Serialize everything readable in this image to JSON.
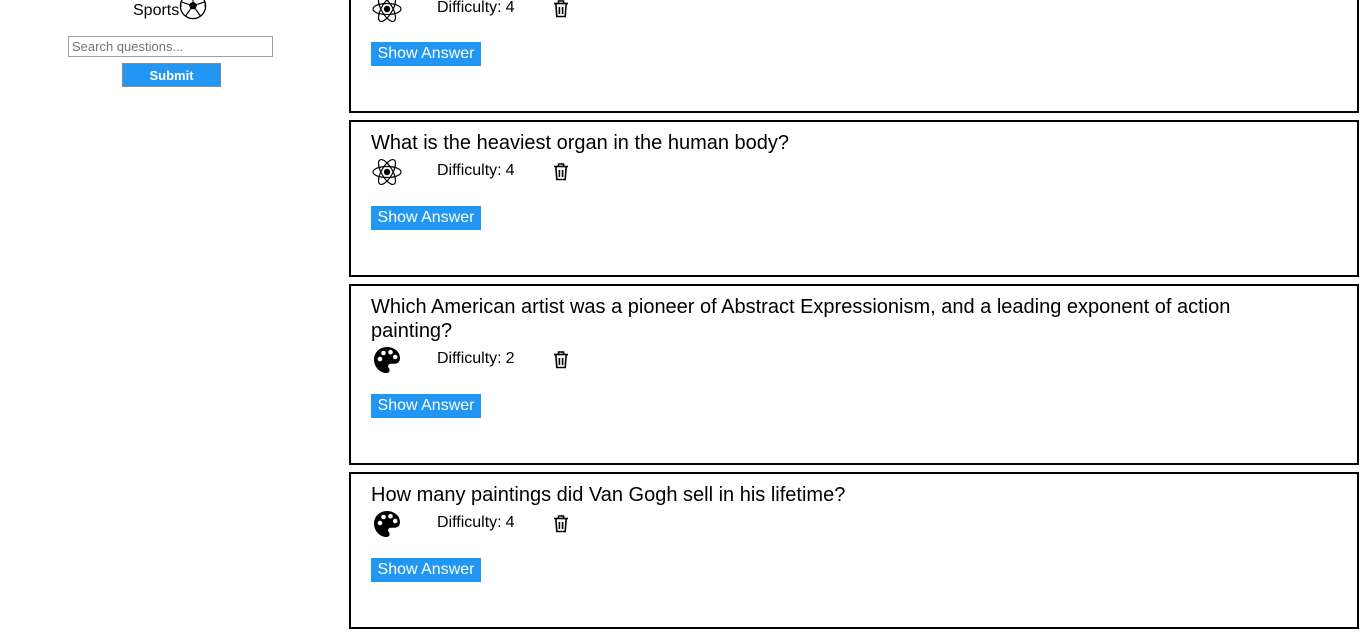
{
  "sidebar": {
    "category_label": "Sports",
    "category_icon": "soccer-ball-icon",
    "search_placeholder": "Search questions...",
    "search_value": "",
    "submit_label": "Submit"
  },
  "questions": [
    {
      "text": "",
      "category_icon": "atom-icon",
      "difficulty_label": "Difficulty:",
      "difficulty": "4",
      "show_answer_label": "Show Answer"
    },
    {
      "text": "What is the heaviest organ in the human body?",
      "category_icon": "atom-icon",
      "difficulty_label": "Difficulty:",
      "difficulty": "4",
      "show_answer_label": "Show Answer"
    },
    {
      "text": "Which American artist was a pioneer of Abstract Expressionism, and a leading exponent of action painting?",
      "category_icon": "palette-icon",
      "difficulty_label": "Difficulty:",
      "difficulty": "2",
      "show_answer_label": "Show Answer"
    },
    {
      "text": "How many paintings did Van Gogh sell in his lifetime?",
      "category_icon": "palette-icon",
      "difficulty_label": "Difficulty:",
      "difficulty": "4",
      "show_answer_label": "Show Answer"
    }
  ],
  "colors": {
    "accent": "#2196f3",
    "card_border": "#000000"
  }
}
